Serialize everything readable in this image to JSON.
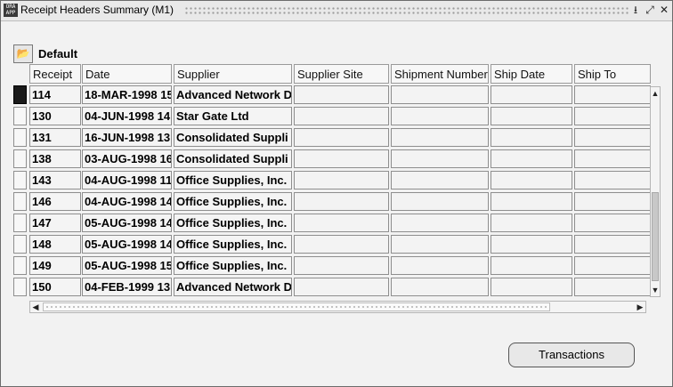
{
  "window": {
    "title": "Receipt Headers Summary (M1)",
    "controls": {
      "minimize": "⭳",
      "maximize": "⤢",
      "close": "✕"
    },
    "icon": "oracle-app-icon"
  },
  "toolbar": {
    "folder_button_icon": "open-folder-icon",
    "folder_name": "Default"
  },
  "columns": [
    "Receipt",
    "Date",
    "Supplier",
    "Supplier Site",
    "Shipment Number",
    "Ship Date",
    "Ship To"
  ],
  "rows": [
    {
      "receipt": "114",
      "date": "18-MAR-1998 15",
      "supplier": "Advanced Network D",
      "active": true
    },
    {
      "receipt": "130",
      "date": "04-JUN-1998 14:",
      "supplier": "Star Gate Ltd"
    },
    {
      "receipt": "131",
      "date": "16-JUN-1998 13:",
      "supplier": "Consolidated Suppli"
    },
    {
      "receipt": "138",
      "date": "03-AUG-1998 16",
      "supplier": "Consolidated Suppli"
    },
    {
      "receipt": "143",
      "date": "04-AUG-1998 11",
      "supplier": "Office Supplies, Inc."
    },
    {
      "receipt": "146",
      "date": "04-AUG-1998 14",
      "supplier": "Office Supplies, Inc."
    },
    {
      "receipt": "147",
      "date": "05-AUG-1998 14",
      "supplier": "Office Supplies, Inc."
    },
    {
      "receipt": "148",
      "date": "05-AUG-1998 14",
      "supplier": "Office Supplies, Inc."
    },
    {
      "receipt": "149",
      "date": "05-AUG-1998 15",
      "supplier": "Office Supplies, Inc."
    },
    {
      "receipt": "150",
      "date": "04-FEB-1999 13:",
      "supplier": "Advanced Network D"
    }
  ],
  "scroll": {
    "up_icon": "▲",
    "down_icon": "▼",
    "left_icon": "◀",
    "right_icon": "▶"
  },
  "buttons": {
    "transactions": "Transactions"
  },
  "colors": {
    "active_row_marker": "#1a1a1a",
    "window_bg": "#f2f2f2"
  }
}
